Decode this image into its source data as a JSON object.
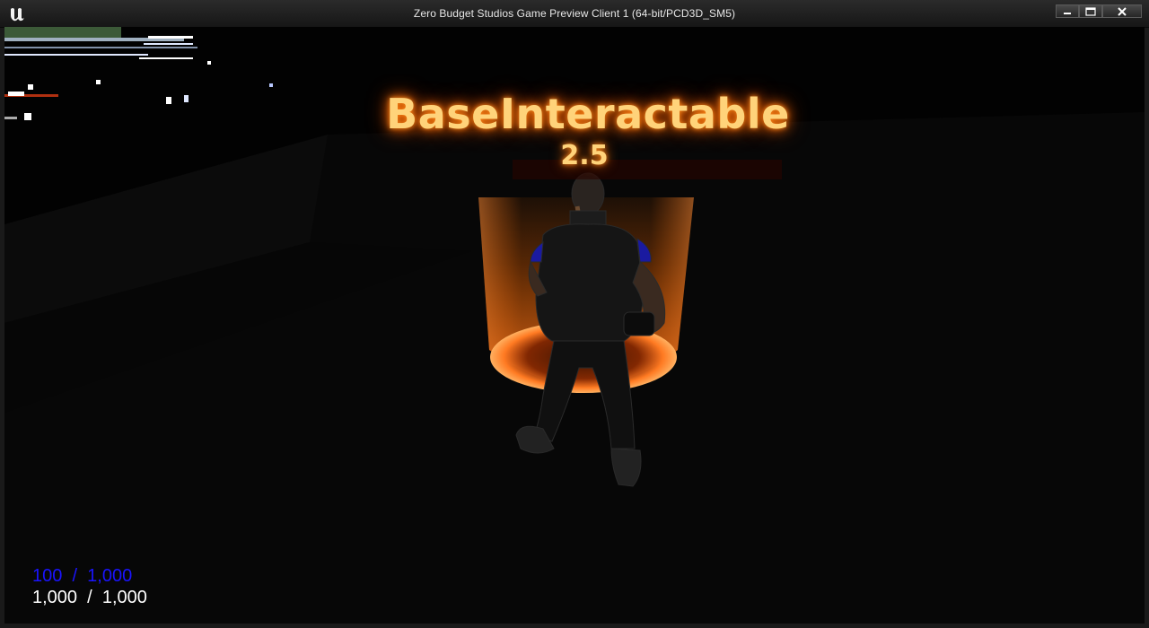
{
  "window": {
    "title": "Zero Budget Studios Game Preview Client 1 (64-bit/PCD3D_SM5)",
    "icons": [
      "unreal-engine-logo",
      "minimize-icon",
      "maximize-icon",
      "close-icon"
    ]
  },
  "interactable": {
    "name": "BaseInteractable",
    "value": "2.5",
    "glow_color": "#ff6a00",
    "text_color": "#ffd37a"
  },
  "hud": {
    "mana": {
      "current": "100",
      "max": "1,000",
      "color": "#1a14ff"
    },
    "health": {
      "current": "1,000",
      "max": "1,000",
      "color": "#ffffff"
    }
  }
}
